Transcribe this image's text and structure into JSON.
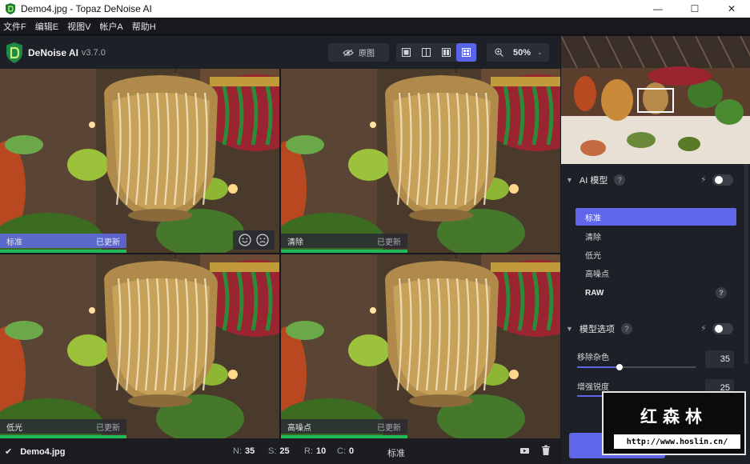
{
  "window": {
    "title": "Demo4.jpg - Topaz DeNoise AI",
    "minimize": "—",
    "maximize": "☐",
    "close": "✕"
  },
  "menu": [
    "文件F",
    "编辑E",
    "视图V",
    "帐户A",
    "帮助H"
  ],
  "header": {
    "brand": "DeNoise AI",
    "version": "v3.7.0",
    "original_label": "原图",
    "zoom_value": "50%",
    "zoom_chevron": "⌄",
    "active_view": "quad-view"
  },
  "panes": [
    {
      "label": "标准",
      "status": "已更新",
      "selected": true
    },
    {
      "label": "清除",
      "status": "已更新",
      "selected": false
    },
    {
      "label": "低光",
      "status": "已更新",
      "selected": false
    },
    {
      "label": "高噪点",
      "status": "已更新",
      "selected": false
    }
  ],
  "status_bar": {
    "check": "✔",
    "filename": "Demo4.jpg",
    "n_label": "N:",
    "n_value": "35",
    "s_label": "S:",
    "s_value": "25",
    "r_label": "R:",
    "r_value": "10",
    "c_label": "C:",
    "c_value": "0",
    "model": "标准"
  },
  "ai_model": {
    "title": "AI 模型",
    "help": "?",
    "auto_enabled": false,
    "items": [
      "标准",
      "清除",
      "低光",
      "高噪点",
      "RAW"
    ],
    "active": "标准"
  },
  "model_options": {
    "title": "模型选项",
    "help": "?",
    "auto_enabled": false,
    "remove_noise_label": "移除杂色",
    "remove_noise_value": "35",
    "sharpen_label": "增强锐度",
    "sharpen_value": "25"
  },
  "watermark": {
    "title": "红森林",
    "url": "http://www.hoslin.cn/"
  },
  "colors": {
    "accent": "#5f66ea",
    "status_green": "#1fbb5b"
  }
}
